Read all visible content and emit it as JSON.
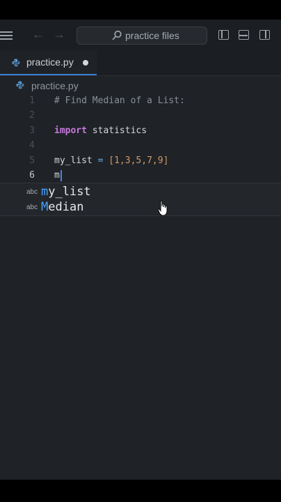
{
  "window": {
    "search_placeholder": "practice files",
    "icons": [
      "hamburger-icon",
      "back-arrow-icon",
      "forward-arrow-icon",
      "search-icon",
      "sidebar-toggle-icon",
      "panel-toggle-icon",
      "split-editor-icon"
    ]
  },
  "tab": {
    "label": "practice.py",
    "unsaved": true
  },
  "breadcrumb": {
    "file": "practice.py"
  },
  "editor": {
    "lines": [
      {
        "n": "1",
        "text": "# Find Median of a List:"
      },
      {
        "n": "2",
        "text": ""
      },
      {
        "n": "3",
        "kw": "import",
        "rest": " statistics"
      },
      {
        "n": "4",
        "text": ""
      },
      {
        "n": "5",
        "text": "my_list = [1,3,5,7,9]"
      },
      {
        "n": "6",
        "text": "m"
      }
    ],
    "line5": {
      "name": "my_list",
      "op": " = ",
      "open": "[",
      "values": "1,3,5,7,9",
      "close": "]"
    }
  },
  "autocomplete": {
    "items": [
      {
        "kind": "abc",
        "label": "my_list",
        "match": "m",
        "rest": "y_list"
      },
      {
        "kind": "abc",
        "label": "Median",
        "match": "M",
        "rest": "edian"
      }
    ]
  },
  "colors": {
    "background": "#1f2226",
    "keyword": "#c678dd",
    "number": "#d19a66",
    "accent": "#3b7fd6"
  }
}
